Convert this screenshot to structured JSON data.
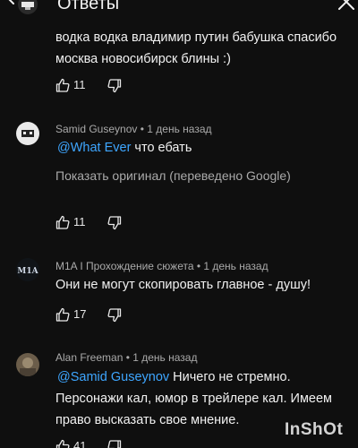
{
  "header": {
    "title": "Ответы"
  },
  "comments": [
    {
      "text_line1": "водка водка владимир путин бабушка спасибо",
      "text_line2": "москва новосибирск блины :)",
      "likes": "11"
    },
    {
      "author": "Samid Guseynov",
      "meta": " • 1 день назад",
      "mention": "@What Ever",
      "text": " что ебать",
      "translate_link": "Показать оригинал (переведено Google)",
      "likes": "11"
    },
    {
      "author": "M1A I Прохождение сюжета",
      "meta": " • 1 день назад",
      "avatar_text": "M1A",
      "text": "Они не могут скопировать главное - душу!",
      "likes": "17"
    },
    {
      "author": "Alan Freeman",
      "meta": " • 1 день назад",
      "mention": "@Samid Guseynov",
      "text_line1": " Ничего не стремно.",
      "text_line2": "Персонажи кал, юмор в трейлере кал. Имеем",
      "text_line3": "право высказать свое мнение.",
      "likes": "41"
    }
  ],
  "watermark": {
    "text": "InShOt"
  },
  "colors": {
    "background": "#0f0f0f",
    "mention": "#3ea6ff",
    "secondary_text": "#aaaaaa"
  },
  "icons": [
    "back-arrow-icon",
    "close-icon",
    "thumb-up-icon",
    "thumb-down-icon"
  ]
}
